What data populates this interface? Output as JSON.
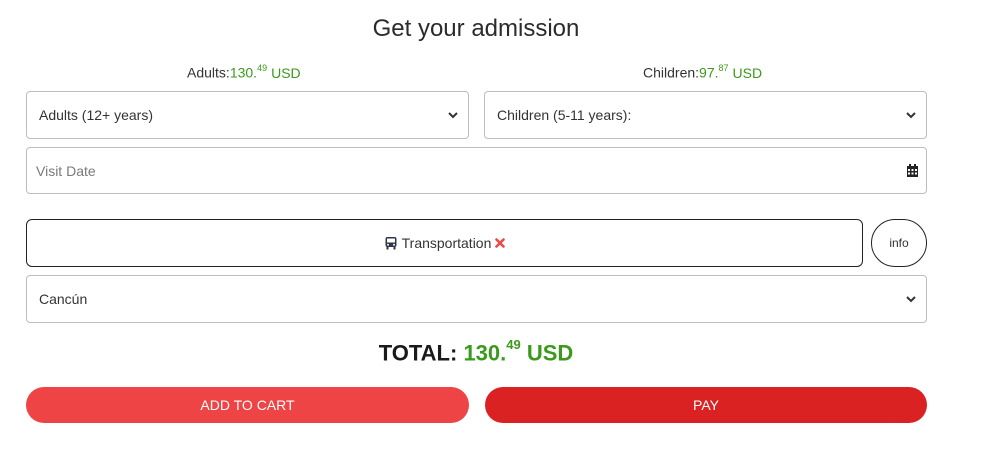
{
  "header": {
    "title": "Get your admission"
  },
  "prices": {
    "adults": {
      "label": "Adults:",
      "whole": "130.",
      "cents": "49",
      "currency": "USD"
    },
    "children": {
      "label": "Children:",
      "whole": "97.",
      "cents": "87",
      "currency": "USD"
    }
  },
  "form": {
    "adults_select": "Adults (12+ years)",
    "children_select": "Children (5-11 years):",
    "visit_date_placeholder": "Visit Date",
    "transportation_label": "Transportation",
    "info_label": "info",
    "location_select": "Cancún"
  },
  "total": {
    "label": "TOTAL:",
    "whole": "130.",
    "cents": "49",
    "currency": "USD"
  },
  "actions": {
    "add_to_cart": "ADD TO CART",
    "pay": "PAY"
  },
  "colors": {
    "green": "#3a9a1c",
    "cart_red": "#ef4446",
    "pay_red": "#db2222",
    "remove_x": "#e94b4b"
  },
  "icons": {
    "calendar": "calendar-icon",
    "bus": "bus-icon",
    "remove": "close-icon",
    "chevron": "chevron-down-icon"
  }
}
